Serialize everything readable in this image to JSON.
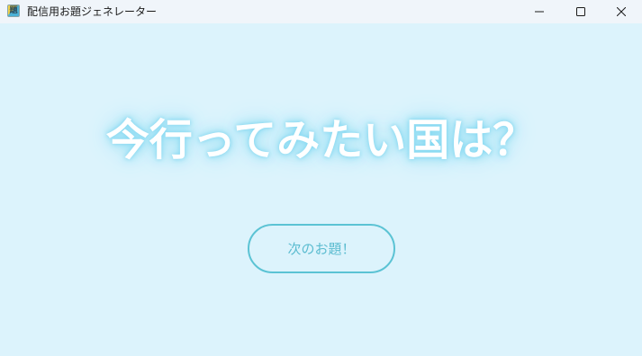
{
  "window": {
    "title": "配信用お題ジェネレーター",
    "icon_glyph": "題",
    "controls": {
      "minimize": "minimize-icon",
      "maximize": "maximize-icon",
      "close": "close-icon"
    }
  },
  "main": {
    "question": "今行ってみたい国は？",
    "next_button_label": "次のお題！"
  },
  "colors": {
    "background": "#dcf3fc",
    "titlebar": "#f0f5fa",
    "accent": "#5bc3d4",
    "glow": "#8edcf3",
    "question_text": "#ffffff"
  }
}
